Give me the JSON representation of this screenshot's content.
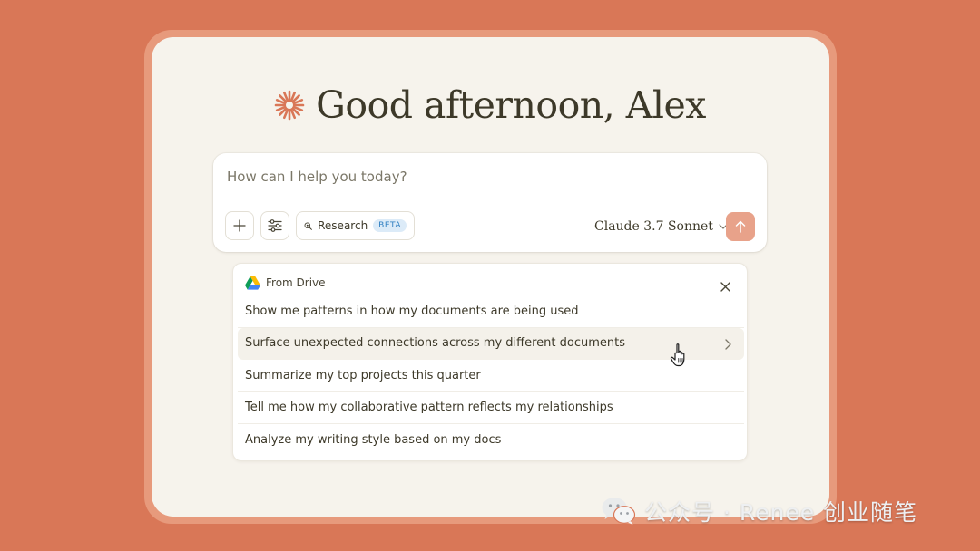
{
  "greeting": {
    "text": "Good afternoon, Alex",
    "icon": "spark-icon",
    "icon_color": "#d97757"
  },
  "composer": {
    "placeholder": "How can I help you today?",
    "value": "",
    "tools": {
      "add_icon": "plus-icon",
      "settings_icon": "sliders-icon",
      "research_label": "Research",
      "research_badge": "BETA"
    },
    "model": {
      "label": "Claude 3.7 Sonnet",
      "icon": "chevron-down-icon"
    },
    "send_icon": "arrow-up-icon"
  },
  "suggestions": {
    "source_label": "From Drive",
    "source_icon": "google-drive-icon",
    "close_icon": "close-icon",
    "items": [
      {
        "label": "Show me patterns in how my documents are being used"
      },
      {
        "label": "Surface unexpected connections across my different documents",
        "active": true
      },
      {
        "label": "Summarize my top projects this quarter"
      },
      {
        "label": "Tell me how my collaborative pattern reflects my relationships"
      },
      {
        "label": "Analyze my writing style based on my docs"
      }
    ]
  },
  "watermark": {
    "text": "公众号 · Renee 创业随笔",
    "icon": "wechat-icon"
  },
  "colors": {
    "background": "#d97757",
    "window": "#f6f3ec",
    "accent": "#d97757",
    "send_button": "#e8a28a",
    "beta_badge": "#dcebf8"
  }
}
